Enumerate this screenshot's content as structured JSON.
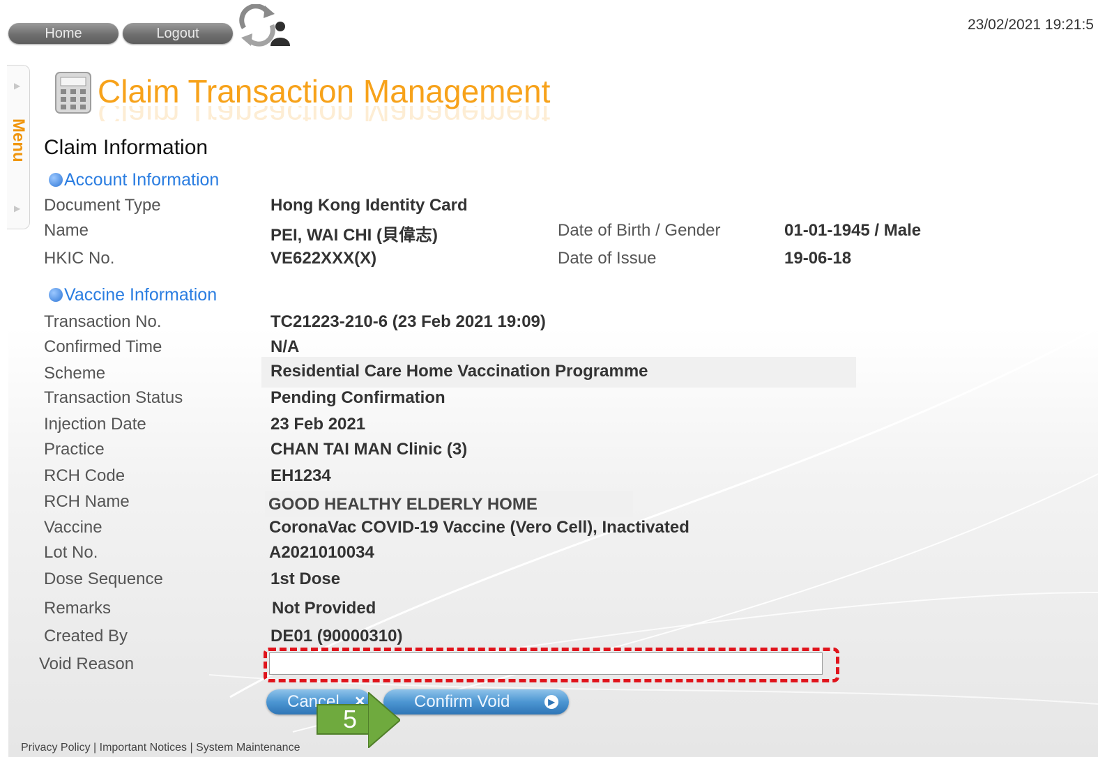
{
  "top": {
    "home_label": "Home",
    "logout_label": "Logout",
    "timestamp": "23/02/2021 19:21:5"
  },
  "menu": {
    "label": "Menu"
  },
  "page": {
    "title": "Claim Transaction Management",
    "section_title": "Claim Information"
  },
  "account": {
    "header": "Account Information",
    "document_type_label": "Document Type",
    "document_type": "Hong Kong Identity Card",
    "name_label": "Name",
    "name": "PEI, WAI CHI (貝偉志)",
    "dob_gender_label": "Date of Birth / Gender",
    "dob_gender": "01-01-1945 / Male",
    "hkic_label": "HKIC No.",
    "hkic": "VE622XXX(X)",
    "date_of_issue_label": "Date of Issue",
    "date_of_issue": "19-06-18"
  },
  "vaccine": {
    "header": "Vaccine Information",
    "rows": [
      {
        "label": "Transaction No.",
        "value": "TC21223-210-6 (23 Feb 2021 19:09)"
      },
      {
        "label": "Confirmed Time",
        "value": "N/A"
      },
      {
        "label": "Scheme",
        "value": "Residential Care Home Vaccination Programme"
      },
      {
        "label": "Transaction Status",
        "value": "Pending Confirmation"
      },
      {
        "label": "Injection Date",
        "value": "23 Feb 2021"
      },
      {
        "label": "Practice",
        "value": "CHAN TAI MAN Clinic (3)"
      },
      {
        "label": "RCH Code",
        "value": "EH1234"
      },
      {
        "label": "RCH Name",
        "value": "GOOD HEALTHY ELDERLY HOME"
      },
      {
        "label": "Vaccine",
        "value": "CoronaVac COVID-19 Vaccine (Vero Cell), Inactivated"
      },
      {
        "label": "Lot No.",
        "value": "A2021010034"
      },
      {
        "label": "Dose Sequence",
        "value": "1st Dose"
      },
      {
        "label": "Remarks",
        "value": "Not Provided"
      },
      {
        "label": "Created By",
        "value": "DE01 (90000310)"
      }
    ]
  },
  "void_reason": {
    "label": "Void Reason",
    "value": "",
    "placeholder": ""
  },
  "actions": {
    "cancel_label": "Cancel",
    "confirm_label": "Confirm Void"
  },
  "annotation": {
    "step": "5",
    "highlight_color": "#e0141c",
    "badge_color": "#6faa3e"
  },
  "footer": {
    "privacy": "Privacy Policy",
    "notices": "Important Notices",
    "maintenance": "System Maintenance"
  },
  "colors": {
    "title": "#f7a21a",
    "sub_header": "#2a7de1",
    "menu": "#f0960e",
    "button_blue": "#4c96d2"
  }
}
